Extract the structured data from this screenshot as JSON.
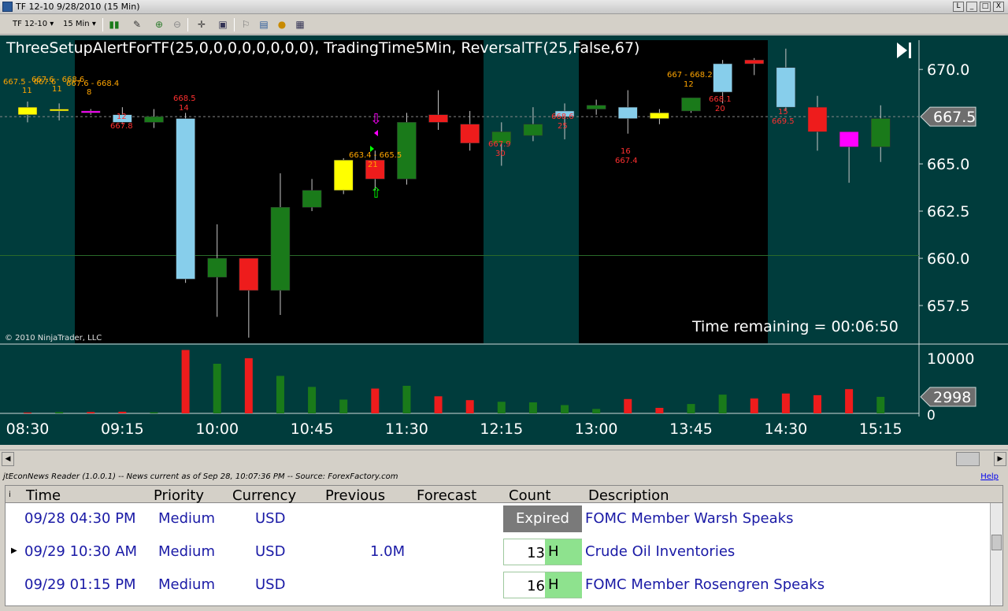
{
  "window": {
    "title": "TF 12-10  9/28/2010 (15 Min)",
    "buttons": [
      "L",
      "_",
      "□",
      "X"
    ]
  },
  "toolbar": {
    "instrument": "TF 12-10",
    "interval": "15 Min"
  },
  "chart": {
    "indicator_text": "ThreeSetupAlertForTF(25,0,0,0,0,0,0,0,0), TradingTime5Min, ReversalTF(25,False,67)",
    "time_remaining": "Time remaining = 00:06:50",
    "copyright": "© 2010 NinjaTrader, LLC",
    "current_price": "667.5",
    "current_volume": "2998",
    "price_ticks": [
      "670.0",
      "667.5",
      "665.0",
      "662.5",
      "660.0",
      "657.5"
    ],
    "volume_ticks": [
      "10000",
      "0"
    ],
    "time_labels": [
      "08:30",
      "09:15",
      "10:00",
      "10:45",
      "11:30",
      "12:15",
      "13:00",
      "13:45",
      "14:30",
      "15:15"
    ],
    "colors": {
      "background": "#003c3c",
      "session": "#000000",
      "up": "#1a7a1a",
      "down": "#ee1c1c",
      "yellow": "#ffff00",
      "lightblue": "#87ceeb",
      "magenta": "#ff00ff"
    },
    "annotations": [
      {
        "text": "667.5 - 667.6",
        "color": "#ffa500"
      },
      {
        "text": "667.6 - 668.6",
        "color": "#ffa500"
      },
      {
        "text": "667.6 - 668.4",
        "color": "#ffa500"
      },
      {
        "text": "11",
        "color": "#ffa500"
      },
      {
        "text": "11",
        "color": "#ffa500"
      },
      {
        "text": "8",
        "color": "#ffa500"
      },
      {
        "text": "12",
        "color": "#ff3030"
      },
      {
        "text": "667.8",
        "color": "#ff3030"
      },
      {
        "text": "668.5",
        "color": "#ff3030"
      },
      {
        "text": "14",
        "color": "#ff3030"
      },
      {
        "text": "663.4 - 665.5",
        "color": "#ffa500"
      },
      {
        "text": "21",
        "color": "#ffa500"
      },
      {
        "text": "667.9",
        "color": "#ff3030"
      },
      {
        "text": "30",
        "color": "#ff3030"
      },
      {
        "text": "668.6",
        "color": "#ff3030"
      },
      {
        "text": "25",
        "color": "#ff3030"
      },
      {
        "text": "16",
        "color": "#ff3030"
      },
      {
        "text": "667.4",
        "color": "#ff3030"
      },
      {
        "text": "667 - 668.2",
        "color": "#ffa500"
      },
      {
        "text": "12",
        "color": "#ffa500"
      },
      {
        "text": "668.1",
        "color": "#ff3030"
      },
      {
        "text": "20",
        "color": "#ff3030"
      },
      {
        "text": "15",
        "color": "#ff3030"
      },
      {
        "text": "669.5",
        "color": "#ff3030"
      }
    ]
  },
  "chart_data": {
    "type": "candlestick",
    "title": "TF 12-10 (15 Min)",
    "ylim": [
      655.5,
      671.8
    ],
    "volume_ylim": [
      0,
      12000
    ],
    "bars": [
      {
        "t": "08:30",
        "o": 668.0,
        "h": 668.3,
        "l": 667.2,
        "c": 667.6,
        "color": "yellow",
        "vol": 150
      },
      {
        "t": "08:45",
        "o": 667.8,
        "h": 668.2,
        "l": 667.3,
        "c": 667.9,
        "color": "yellow",
        "vol": 250
      },
      {
        "t": "09:00",
        "o": 667.8,
        "h": 667.9,
        "l": 667.6,
        "c": 667.7,
        "color": "magenta",
        "vol": 250
      },
      {
        "t": "09:15",
        "o": 667.6,
        "h": 668.0,
        "l": 667.1,
        "c": 667.2,
        "color": "lightblue",
        "vol": 300
      },
      {
        "t": "09:30",
        "o": 667.2,
        "h": 667.9,
        "l": 666.9,
        "c": 667.5,
        "color": "up",
        "vol": 200
      },
      {
        "t": "09:45",
        "o": 667.4,
        "h": 667.7,
        "l": 658.7,
        "c": 658.9,
        "color": "lightblue",
        "vol": 11500
      },
      {
        "t": "10:00",
        "o": 659.0,
        "h": 661.8,
        "l": 656.9,
        "c": 660.0,
        "color": "up",
        "vol": 9000
      },
      {
        "t": "10:15",
        "o": 660.0,
        "h": 660.0,
        "l": 655.8,
        "c": 658.3,
        "color": "down",
        "vol": 10000
      },
      {
        "t": "10:30",
        "o": 658.3,
        "h": 664.5,
        "l": 657.0,
        "c": 662.7,
        "color": "up",
        "vol": 6800
      },
      {
        "t": "10:45",
        "o": 662.7,
        "h": 664.2,
        "l": 662.5,
        "c": 663.6,
        "color": "up",
        "vol": 4800
      },
      {
        "t": "11:00",
        "o": 663.6,
        "h": 665.3,
        "l": 663.4,
        "c": 665.2,
        "color": "yellow",
        "vol": 2500
      },
      {
        "t": "11:15",
        "o": 665.2,
        "h": 665.7,
        "l": 663.6,
        "c": 664.2,
        "color": "down",
        "vol": 4500
      },
      {
        "t": "11:30",
        "o": 664.2,
        "h": 667.7,
        "l": 663.9,
        "c": 667.2,
        "color": "up",
        "vol": 5000
      },
      {
        "t": "11:45",
        "o": 667.6,
        "h": 668.9,
        "l": 666.8,
        "c": 667.2,
        "color": "down",
        "vol": 3100
      },
      {
        "t": "12:00",
        "o": 667.1,
        "h": 667.8,
        "l": 665.7,
        "c": 666.1,
        "color": "down",
        "vol": 2400
      },
      {
        "t": "12:15",
        "o": 666.1,
        "h": 667.2,
        "l": 664.9,
        "c": 666.7,
        "color": "up",
        "vol": 2100
      },
      {
        "t": "12:30",
        "o": 666.5,
        "h": 668.0,
        "l": 666.2,
        "c": 667.1,
        "color": "up",
        "vol": 2000
      },
      {
        "t": "12:45",
        "o": 667.5,
        "h": 668.2,
        "l": 666.3,
        "c": 667.8,
        "color": "lightblue",
        "vol": 1500
      },
      {
        "t": "13:00",
        "o": 667.9,
        "h": 668.4,
        "l": 667.6,
        "c": 668.1,
        "color": "up",
        "vol": 800
      },
      {
        "t": "13:15",
        "o": 668.0,
        "h": 668.9,
        "l": 666.6,
        "c": 667.4,
        "color": "lightblue",
        "vol": 2600
      },
      {
        "t": "13:30",
        "o": 667.7,
        "h": 667.9,
        "l": 667.1,
        "c": 667.4,
        "color": "yellow",
        "vol": 1000
      },
      {
        "t": "13:45",
        "o": 667.8,
        "h": 668.5,
        "l": 667.7,
        "c": 668.5,
        "color": "up",
        "vol": 1700
      },
      {
        "t": "14:00",
        "o": 668.8,
        "h": 670.5,
        "l": 668.2,
        "c": 670.3,
        "color": "lightblue",
        "vol": 3400
      },
      {
        "t": "14:15",
        "o": 670.5,
        "h": 670.6,
        "l": 669.7,
        "c": 670.3,
        "color": "down",
        "vol": 2700
      },
      {
        "t": "14:30",
        "o": 670.1,
        "h": 671.1,
        "l": 667.8,
        "c": 668.0,
        "color": "lightblue",
        "vol": 3600
      },
      {
        "t": "14:45",
        "o": 668.0,
        "h": 668.6,
        "l": 665.7,
        "c": 666.7,
        "color": "down",
        "vol": 3300
      },
      {
        "t": "15:00",
        "o": 666.7,
        "h": 666.7,
        "l": 664.0,
        "c": 665.9,
        "color": "magenta",
        "vol": 4400
      },
      {
        "t": "15:15",
        "o": 665.9,
        "h": 668.1,
        "l": 665.1,
        "c": 667.4,
        "color": "up",
        "vol": 2998
      }
    ]
  },
  "news": {
    "info": "jtEconNews Reader (1.0.0.1)  --  News current as of Sep 28, 10:07:36 PM  --  Source: ForexFactory.com",
    "help": "Help",
    "columns": [
      "Time",
      "Priority",
      "Currency",
      "Previous",
      "Forecast",
      "Count",
      "Description"
    ],
    "rows": [
      {
        "time": "09/28 04:30 PM",
        "priority": "Medium",
        "currency": "USD",
        "previous": "",
        "forecast": "",
        "count": "Expired",
        "unit": "",
        "description": "FOMC Member Warsh Speaks"
      },
      {
        "time": "09/29 10:30 AM",
        "priority": "Medium",
        "currency": "USD",
        "previous": "1.0M",
        "forecast": "",
        "count": "13",
        "unit": "H",
        "description": "Crude Oil Inventories"
      },
      {
        "time": "09/29 01:15 PM",
        "priority": "Medium",
        "currency": "USD",
        "previous": "",
        "forecast": "",
        "count": "16",
        "unit": "H",
        "description": "FOMC Member Rosengren Speaks"
      }
    ]
  }
}
